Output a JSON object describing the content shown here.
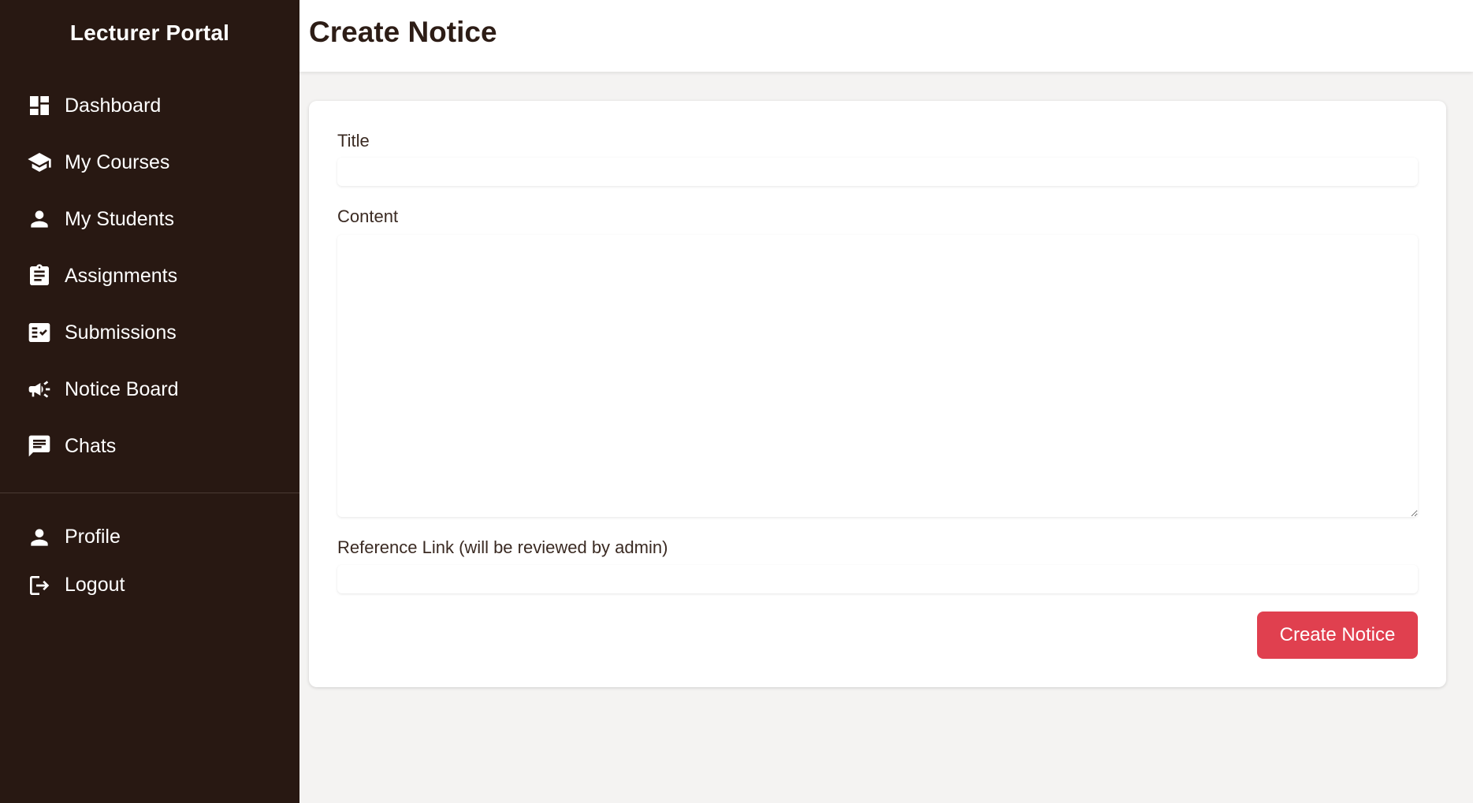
{
  "sidebar": {
    "brand": "Lecturer Portal",
    "items": [
      {
        "label": "Dashboard",
        "icon": "dashboard-icon"
      },
      {
        "label": "My Courses",
        "icon": "school-icon"
      },
      {
        "label": "My Students",
        "icon": "person-icon"
      },
      {
        "label": "Assignments",
        "icon": "clipboard-icon"
      },
      {
        "label": "Submissions",
        "icon": "checklist-icon"
      },
      {
        "label": "Notice Board",
        "icon": "megaphone-icon"
      },
      {
        "label": "Chats",
        "icon": "chat-icon"
      }
    ],
    "bottom_items": [
      {
        "label": "Profile",
        "icon": "person-icon"
      },
      {
        "label": "Logout",
        "icon": "logout-icon"
      }
    ]
  },
  "header": {
    "title": "Create Notice"
  },
  "form": {
    "title_label": "Title",
    "title_value": "",
    "content_label": "Content",
    "content_value": "",
    "link_label": "Reference Link (will be reviewed by admin)",
    "link_value": "",
    "submit_label": "Create Notice"
  },
  "colors": {
    "sidebar_bg": "#281812",
    "accent": "#e0404f",
    "page_bg": "#f4f3f2"
  }
}
